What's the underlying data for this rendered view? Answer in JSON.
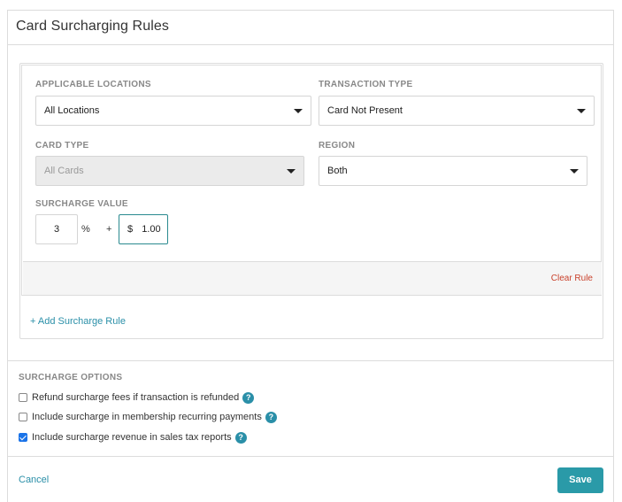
{
  "header": {
    "title": "Card Surcharging Rules"
  },
  "rule": {
    "applicable_locations": {
      "label": "APPLICABLE LOCATIONS",
      "value": "All Locations"
    },
    "transaction_type": {
      "label": "TRANSACTION TYPE",
      "value": "Card Not Present"
    },
    "card_type": {
      "label": "CARD TYPE",
      "value": "All Cards",
      "disabled": true
    },
    "region": {
      "label": "REGION",
      "value": "Both"
    },
    "surcharge_value": {
      "label": "SURCHARGE VALUE",
      "percent_value": "3",
      "percent_symbol": "%",
      "plus_symbol": "+",
      "currency_symbol": "$",
      "fixed_value": "1.00"
    },
    "clear_rule_label": "Clear Rule"
  },
  "add_rule_label": "+ Add Surcharge Rule",
  "options": {
    "label": "SURCHARGE OPTIONS",
    "items": [
      {
        "label": "Refund surcharge fees if transaction is refunded",
        "checked": false,
        "icon": "help-icon"
      },
      {
        "label": "Include surcharge in membership recurring payments",
        "checked": false,
        "icon": "help-icon"
      },
      {
        "label": "Include surcharge revenue in sales tax reports",
        "checked": true,
        "icon": "help-icon"
      }
    ],
    "help_glyph": "?"
  },
  "footer": {
    "cancel_label": "Cancel",
    "save_label": "Save"
  },
  "colors": {
    "accent": "#2a9aa8",
    "link": "#2a8fa8",
    "danger": "#c9412b",
    "checkbox": "#1a73e8"
  }
}
